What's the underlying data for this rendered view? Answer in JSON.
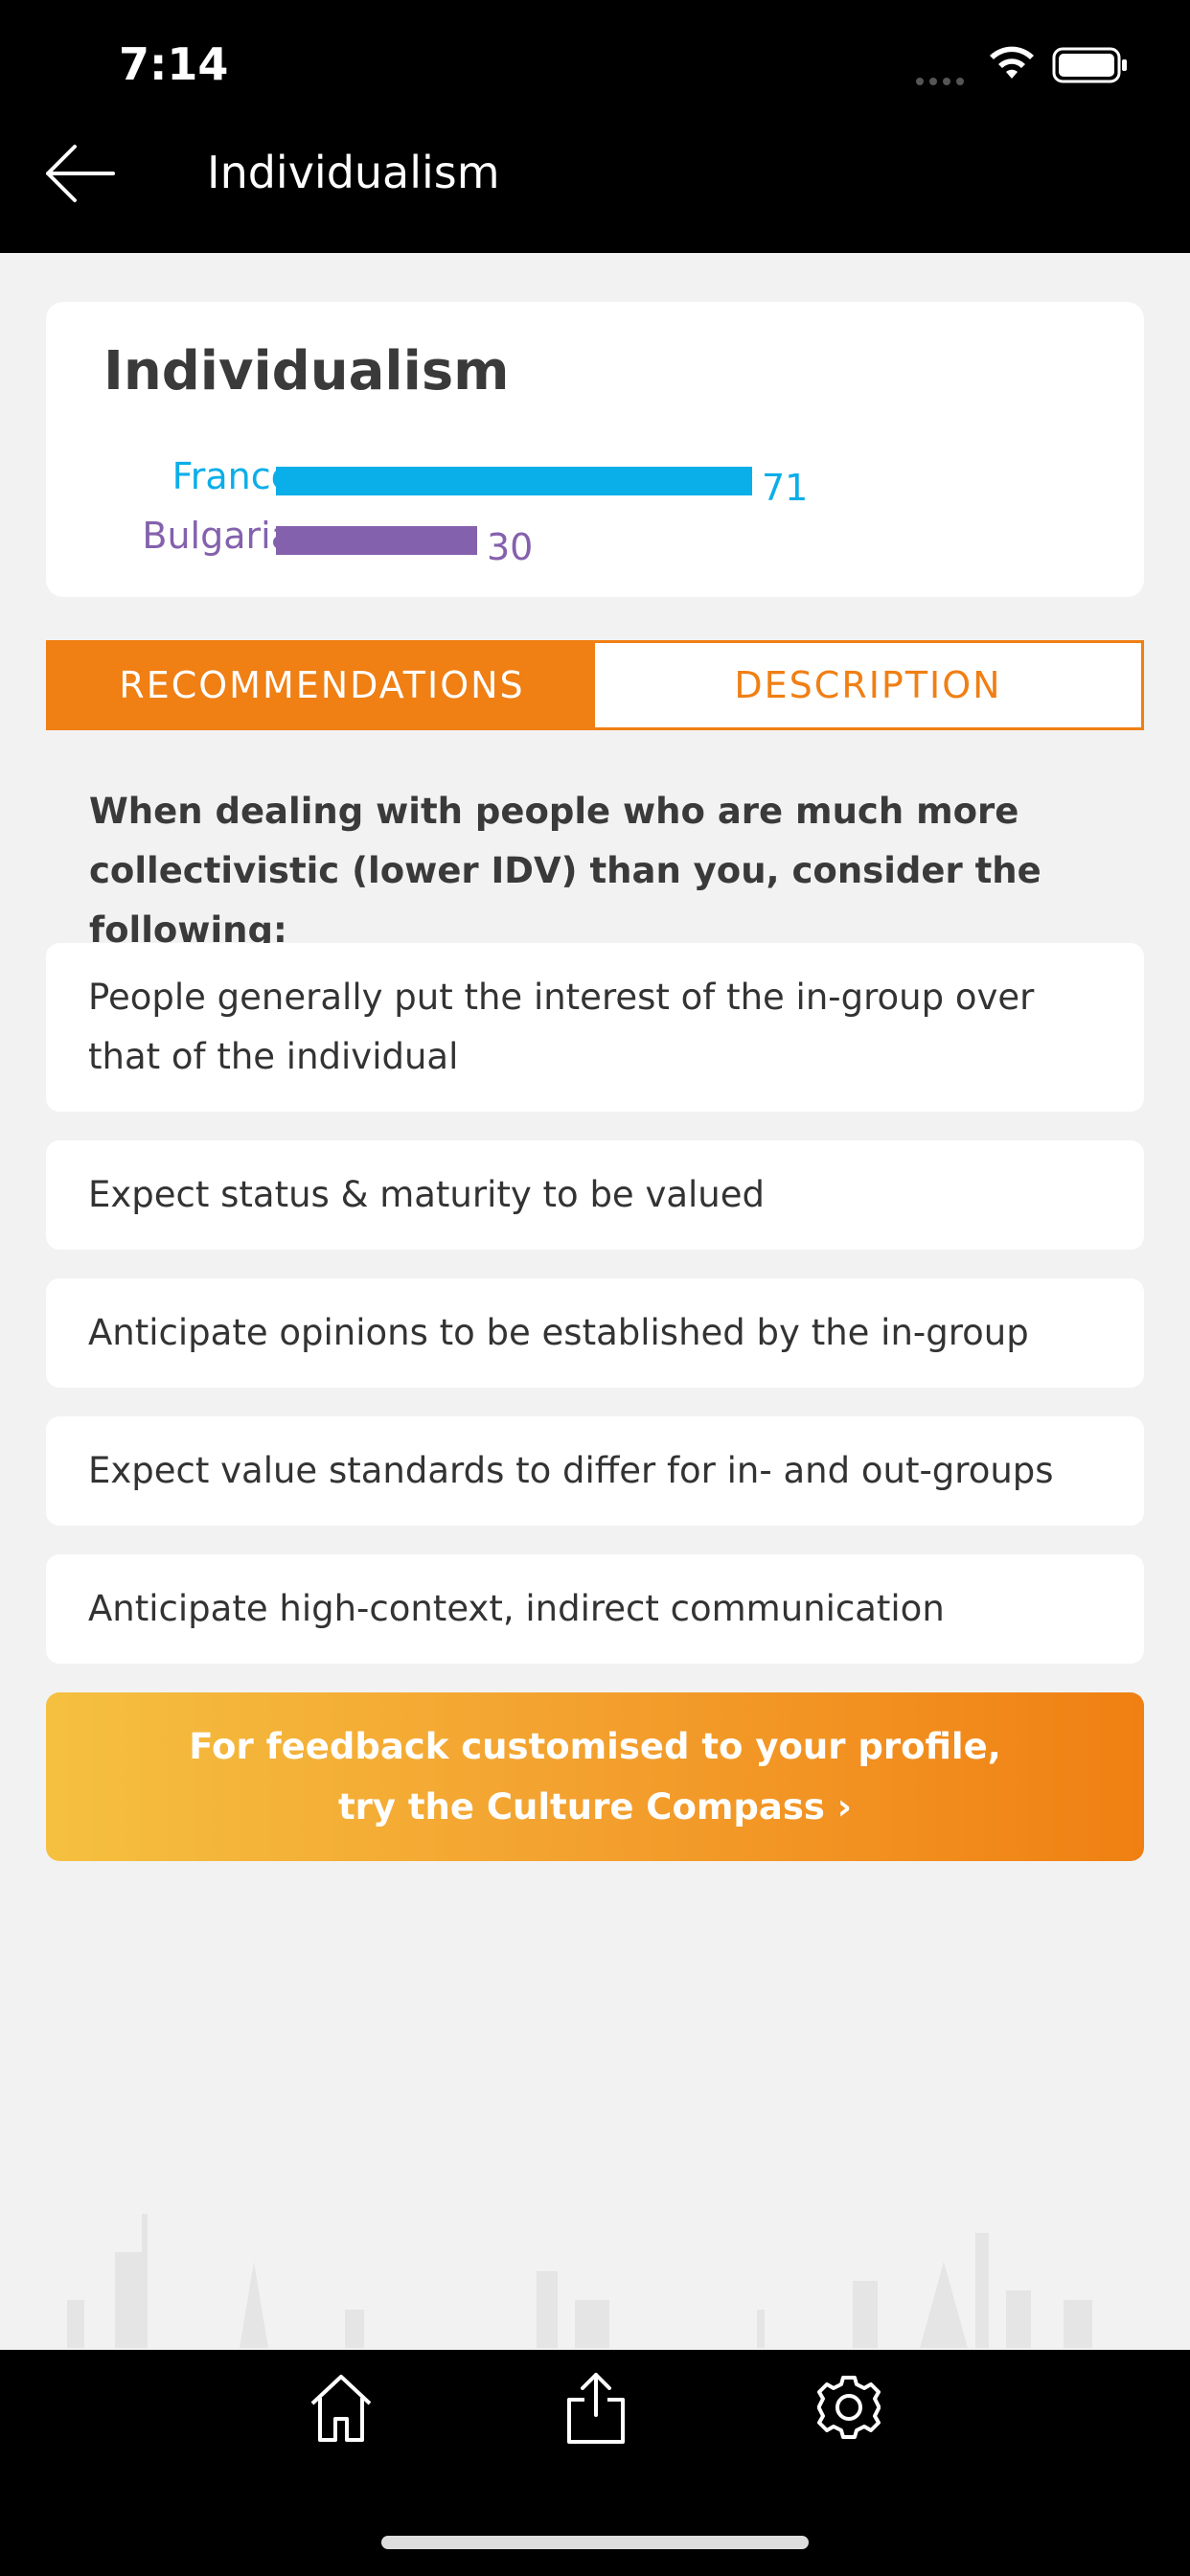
{
  "status_bar": {
    "time": "7:14"
  },
  "nav": {
    "title": "Individualism",
    "back_icon": "arrow-left-icon"
  },
  "dimension_card": {
    "title": "Individualism",
    "bars": [
      {
        "country": "France",
        "value": 71,
        "color": "#0aaee8"
      },
      {
        "country": "Bulgaria",
        "value": 30,
        "color": "#8461ad"
      }
    ]
  },
  "tabs": [
    {
      "label": "RECOMMENDATIONS",
      "active": true
    },
    {
      "label": "DESCRIPTION",
      "active": false
    }
  ],
  "intro": "When dealing with people who are much more collectivistic (lower IDV) than you, consider the following:",
  "recommendations": [
    "People generally put the interest of the in-group over that of the individual",
    "Expect status & maturity to be valued",
    "Anticipate opinions to be established by the in-group",
    "Expect value standards to differ for in- and out-groups",
    "Anticipate high-context, indirect communication"
  ],
  "cta": {
    "line1": "For feedback customised to your profile,",
    "line2": "try the Culture Compass ›"
  },
  "tab_bar": {
    "icons": [
      "home-icon",
      "share-icon",
      "gear-icon"
    ]
  },
  "colors": {
    "accent": "#f07f14",
    "header": "#000000"
  }
}
